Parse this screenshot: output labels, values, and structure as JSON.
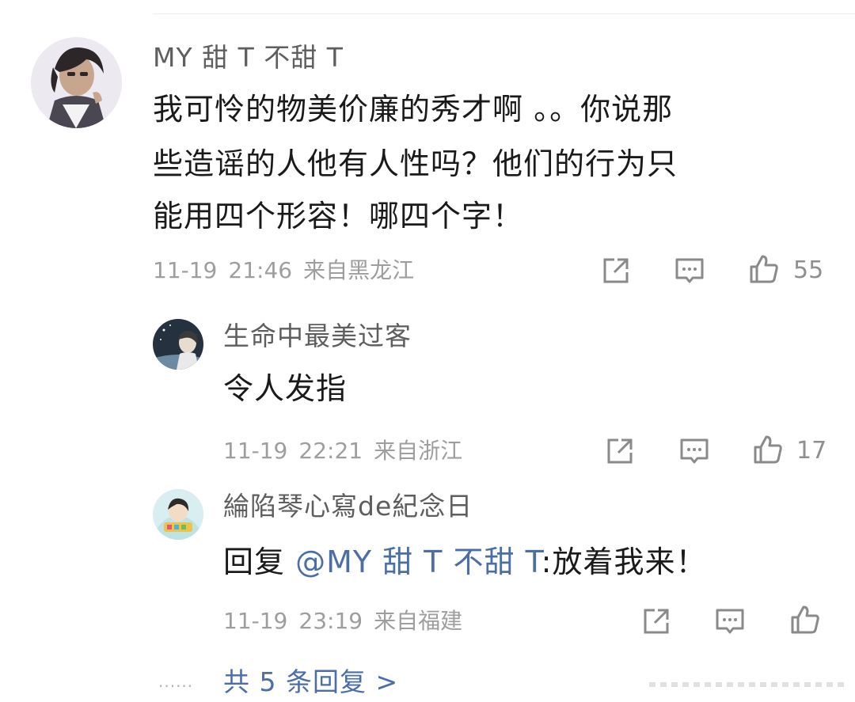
{
  "comments": [
    {
      "username": "MY 甜 T 不甜 T",
      "lines": [
        "我可怜的物美价廉的秀才啊 。。你说那",
        "些造谣的人他有人性吗？他们的行为只",
        "能用四个形容！哪四个字！"
      ],
      "date": "11-19",
      "time": "21:46",
      "location": "来自黑龙江",
      "likes": "55",
      "avatar_icon": "anime-avatar-icon"
    }
  ],
  "replies": [
    {
      "username": "生命中最美过客",
      "text": "令人发指",
      "date": "11-19",
      "time": "22:21",
      "location": "来自浙江",
      "likes": "17",
      "avatar_icon": "night-avatar-icon"
    },
    {
      "username": "綸陷琴心寫de紀念日",
      "reply_prefix": "回复 ",
      "mention": "@MY 甜 T 不甜 T",
      "reply_text": ":放着我来！",
      "date": "11-19",
      "time": "23:19",
      "location": "来自福建",
      "likes": "",
      "avatar_icon": "birthday-avatar-icon"
    }
  ],
  "footer": {
    "dots": "······",
    "more_replies": "共 5 条回复 >"
  },
  "colors": {
    "link": "#4b6ea8",
    "meta": "#9e9e9e",
    "username": "#5e5e5e"
  }
}
